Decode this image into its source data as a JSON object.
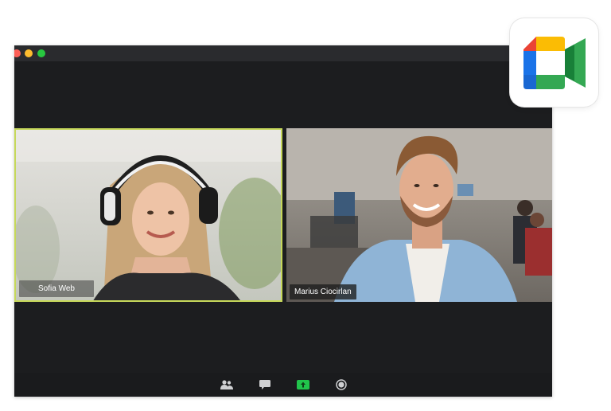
{
  "window": {
    "controls": [
      "close",
      "minimize",
      "zoom"
    ]
  },
  "participants": [
    {
      "name": "Sofia Web",
      "active_speaker": true
    },
    {
      "name": "Marius Ciocirlan",
      "active_speaker": false
    }
  ],
  "toolbar": {
    "icons": [
      "participants-icon",
      "chat-icon",
      "share-screen-icon",
      "record-icon"
    ]
  },
  "app_icon": {
    "name": "google-meet-icon"
  },
  "colors": {
    "speaker_border": "#c6d85a",
    "share_green": "#21c44b",
    "window_bg": "#1c1d1f"
  }
}
